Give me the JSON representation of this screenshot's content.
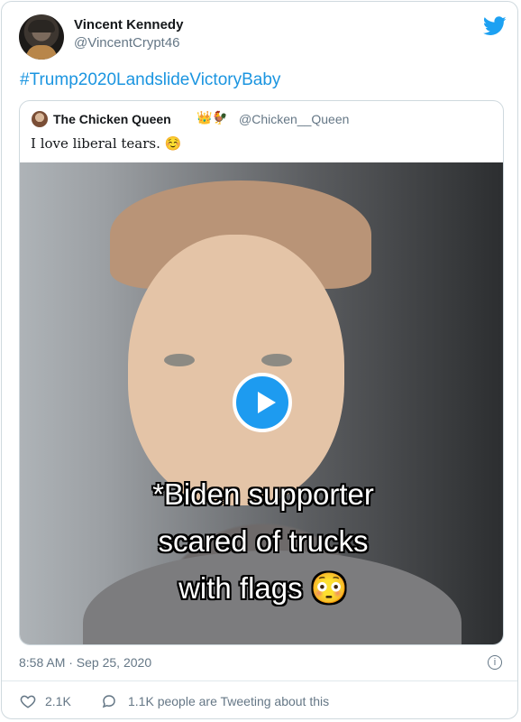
{
  "author": {
    "name": "Vincent Kennedy",
    "handle": "@VincentCrypt46"
  },
  "brand": {
    "icon": "twitter-bird-icon",
    "color": "#1da1f2"
  },
  "tweet_text": "#Trump2020LandslideVictoryBaby",
  "quoted": {
    "name": "The Chicken Queen",
    "name_emoji": "👑🐓",
    "handle": "@Chicken__Queen",
    "text": "I love liberal tears. ☺️",
    "media": {
      "type": "video",
      "play_icon": "play-icon",
      "caption_lines": [
        "*Biden supporter",
        "scared of trucks",
        "with flags 😳"
      ]
    }
  },
  "meta": {
    "timestamp": "8:58 AM · Sep 25, 2020",
    "info_icon": "info-icon"
  },
  "actions": {
    "like_count": "2.1K",
    "reply_text": "1.1K people are Tweeting about this"
  },
  "colors": {
    "link": "#1b95e0",
    "muted": "#657786",
    "play": "#1d9bf0"
  }
}
